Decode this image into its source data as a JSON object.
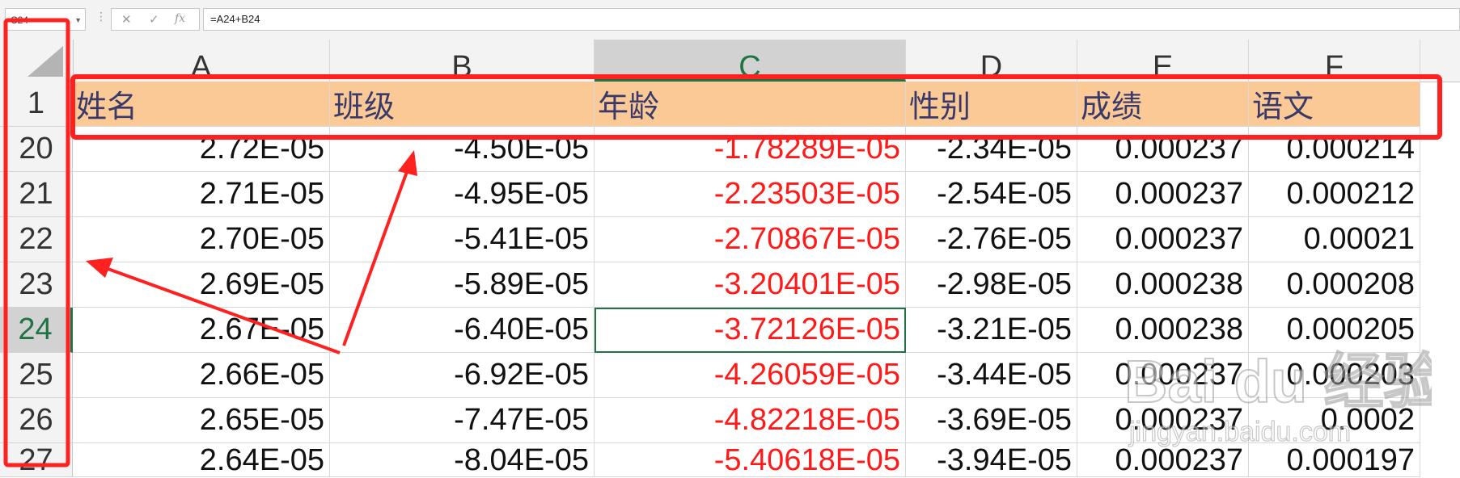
{
  "formula_bar": {
    "name_box": "C24",
    "cancel_glyph": "✕",
    "enter_glyph": "✓",
    "fx_glyph": "fx",
    "formula": "=A24+B24"
  },
  "columns": [
    {
      "key": "A",
      "label": "A"
    },
    {
      "key": "B",
      "label": "B"
    },
    {
      "key": "C",
      "label": "C"
    },
    {
      "key": "D",
      "label": "D"
    },
    {
      "key": "E",
      "label": "E"
    },
    {
      "key": "F",
      "label": "F"
    }
  ],
  "header_row": {
    "row_label": "1",
    "cells": [
      "姓名",
      "班级",
      "年龄",
      "性别",
      "成绩",
      "语文"
    ]
  },
  "rows": [
    {
      "label": "20",
      "cells": [
        "2.72E-05",
        "-4.50E-05",
        "-1.78289E-05",
        "-2.34E-05",
        "0.000237",
        "0.000214"
      ]
    },
    {
      "label": "21",
      "cells": [
        "2.71E-05",
        "-4.95E-05",
        "-2.23503E-05",
        "-2.54E-05",
        "0.000237",
        "0.000212"
      ]
    },
    {
      "label": "22",
      "cells": [
        "2.70E-05",
        "-5.41E-05",
        "-2.70867E-05",
        "-2.76E-05",
        "0.000237",
        "0.00021"
      ]
    },
    {
      "label": "23",
      "cells": [
        "2.69E-05",
        "-5.89E-05",
        "-3.20401E-05",
        "-2.98E-05",
        "0.000238",
        "0.000208"
      ]
    },
    {
      "label": "24",
      "cells": [
        "2.67E-05",
        "-6.40E-05",
        "-3.72126E-05",
        "-3.21E-05",
        "0.000238",
        "0.000205"
      ]
    },
    {
      "label": "25",
      "cells": [
        "2.66E-05",
        "-6.92E-05",
        "-4.26059E-05",
        "-3.44E-05",
        "0.000237",
        "0.000203"
      ]
    },
    {
      "label": "26",
      "cells": [
        "2.65E-05",
        "-7.47E-05",
        "-4.82218E-05",
        "-3.69E-05",
        "0.000237",
        "0.0002"
      ]
    },
    {
      "label": "27",
      "cells": [
        "2.64E-05",
        "-8.04E-05",
        "-5.40618E-05",
        "-3.94E-05",
        "0.000237",
        "0.000197"
      ]
    }
  ],
  "selection": {
    "column": "C",
    "row": "24"
  },
  "colors": {
    "header_fill": "#fbc996",
    "red_text": "#ff1a1a",
    "annotation": "#ff2020",
    "selection_green": "#217346"
  },
  "watermark": {
    "brand_text": "Bai du 经验",
    "sub_text": "jingyan.baidu.com"
  }
}
